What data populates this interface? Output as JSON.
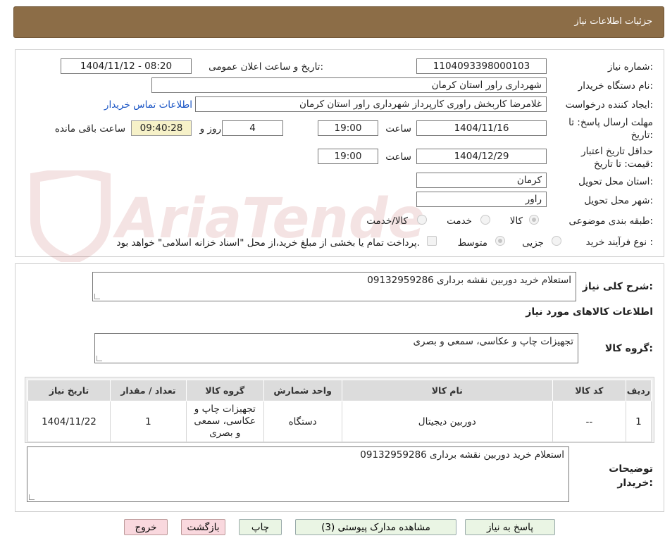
{
  "header": {
    "title": "جزئیات اطلاعات نیاز"
  },
  "watermark": {
    "text": "AriaTender.neT"
  },
  "fields": {
    "need_number_label": "شماره نیاز:",
    "need_number": "1104093398000103",
    "announce_label": "تاریخ و ساعت اعلان عمومی:",
    "announce_value": "1404/11/12 - 08:20",
    "buyer_org_label": "نام دستگاه خریدار:",
    "buyer_org": "شهرداری راور استان کرمان",
    "requester_label": "ایجاد کننده درخواست:",
    "requester": "غلامرضا کاربخش راوری کارپرداز  شهرداری راور استان کرمان",
    "contact_link": "اطلاعات تماس خریدار",
    "deadline_label": "مهلت ارسال پاسخ: تا تاریخ:",
    "deadline_date": "1404/11/16",
    "time_label": "ساعت",
    "deadline_time": "19:00",
    "days_value": "4",
    "days_label": "روز و",
    "remaining_time": "09:40:28",
    "remaining_label": "ساعت باقی مانده",
    "validity_label": "حداقل تاریخ اعتبار قیمت: تا تاریخ:",
    "validity_date": "1404/12/29",
    "validity_time": "19:00",
    "province_label": "استان محل تحویل:",
    "province": "کرمان",
    "city_label": "شهر محل تحویل:",
    "city": "راور",
    "category_label": "طبقه بندی موضوعی:",
    "category_options": [
      "کالا",
      "خدمت",
      "کالا/خدمت"
    ],
    "process_label": "نوع فرآیند خرید :",
    "process_options": [
      "جزیی",
      "متوسط"
    ],
    "payment_note": "پرداخت تمام یا بخشی از مبلغ خرید،از محل \"اسناد خزانه اسلامی\" خواهد بود."
  },
  "summary": {
    "label": "شرح کلی نیاز:",
    "value": "استعلام خرید دوربین نقشه برداری 09132959286",
    "goods_info_title": "اطلاعات کالاهای مورد نیاز",
    "group_label": "گروه کالا:",
    "group_value": "تجهیزات چاپ و عکاسی، سمعی و بصری"
  },
  "table": {
    "headers": [
      "ردیف",
      "کد کالا",
      "نام کالا",
      "واحد شمارش",
      "گروه کالا",
      "تعداد / مقدار",
      "تاریخ نیاز"
    ],
    "rows": [
      [
        "1",
        "--",
        "دوربین دیجیتال",
        "دستگاه",
        "تجهیزات چاپ و عکاسی، سمعی و بصری",
        "1",
        "1404/11/22"
      ]
    ]
  },
  "notes": {
    "label": "توضیحات خریدار:",
    "value": "استعلام خرید دوربین نقشه برداری 09132959286"
  },
  "buttons": {
    "reply": "پاسخ به نیاز",
    "attachments": "مشاهده مدارک پیوستی (3)",
    "print": "چاپ",
    "back": "بازگشت",
    "exit": "خروج"
  }
}
